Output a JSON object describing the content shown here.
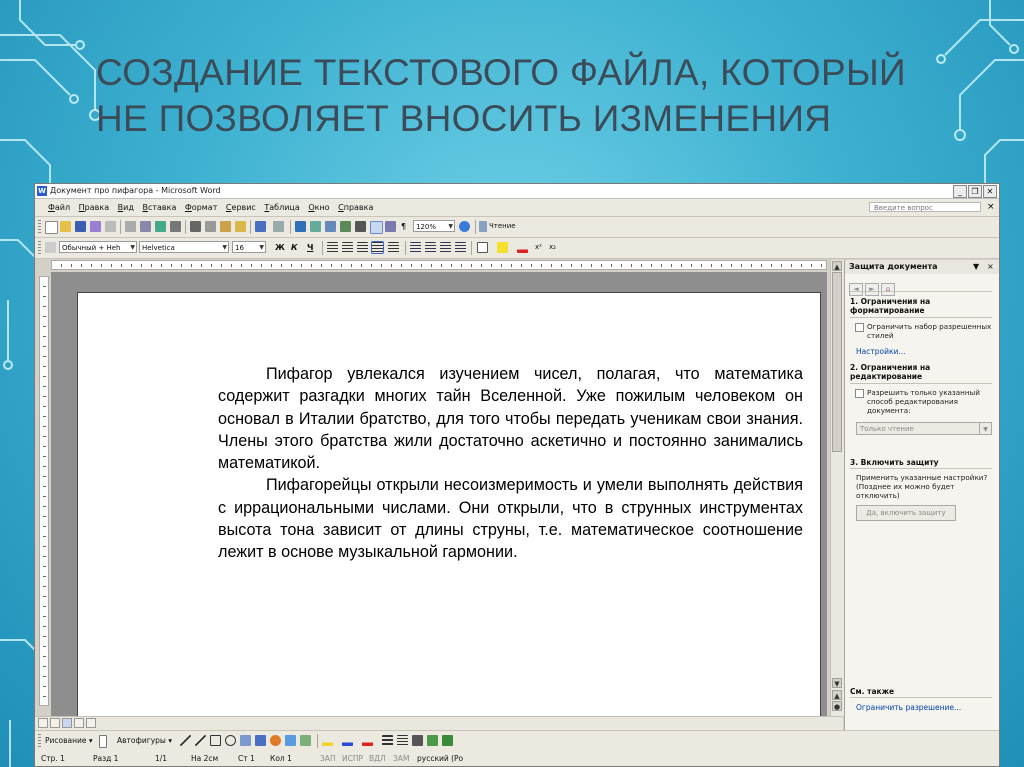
{
  "slide": {
    "title_line1": "СОЗДАНИЕ ТЕКСТОВОГО ФАЙЛА, КОТОРЫЙ",
    "title_line2": "НЕ ПОЗВОЛЯЕТ ВНОСИТЬ ИЗМЕНЕНИЯ"
  },
  "window": {
    "title": "Документ про пифагора - Microsoft Word",
    "icon_letter": "W",
    "minimize": "_",
    "restore": "❐",
    "close": "✕"
  },
  "menu": {
    "items": [
      "Файл",
      "Правка",
      "Вид",
      "Вставка",
      "Формат",
      "Сервис",
      "Таблица",
      "Окно",
      "Справка"
    ],
    "help_placeholder": "Введите вопрос",
    "help_close": "×"
  },
  "toolbar": {
    "zoom": "120%",
    "reading": "Чтение",
    "style": "Обычный + Неh",
    "font": "Helvetica",
    "size": "16",
    "bold": "Ж",
    "italic": "К",
    "underline": "Ч"
  },
  "document": {
    "paragraphs": [
      "Пифагор увлекался изучением чисел, полагая, что математика содержит разгадки многих тайн Вселенной. Уже пожилым человеком он основал в Италии братство, для того чтобы передать ученикам свои знания. Члены этого братства жили достаточно аскетично и постоянно занимались математикой.",
      "Пифагорейцы открыли несоизмеримость и умели выполнять действия с иррациональными числами. Они открыли, что в струнных инструментах высота тона зависит от длины струны, т.е. математическое соотношение лежит в основе музыкальной гармонии."
    ]
  },
  "taskpane": {
    "title": "Защита документа",
    "close": "×",
    "sec1": "1. Ограничения на форматирование",
    "sec1_check": "Ограничить набор разрешенных стилей",
    "sec1_link": "Настройки...",
    "sec2": "2. Ограничения на редактирование",
    "sec2_check": "Разрешить только указанный способ редактирования документа:",
    "sec2_combo": "Только чтение",
    "sec3": "3. Включить защиту",
    "sec3_text": "Применить указанные настройки? (Позднее их можно будет отключить)",
    "sec3_button": "Да, включить защиту",
    "see_also": "См. также",
    "see_also_link": "Ограничить разрешение..."
  },
  "drawbar": {
    "drawing": "Рисование",
    "autoshapes": "Автофигуры"
  },
  "status": {
    "page": "Стр. 1",
    "section": "Разд 1",
    "pages": "1/1",
    "at": "На 2см",
    "line": "Ст 1",
    "col": "Кол 1",
    "rec": "ЗАП",
    "trk": "ИСПР",
    "ext": "ВДЛ",
    "ovr": "ЗАМ",
    "lang": "русский (Ро"
  },
  "colors": {
    "slide_bg": "#3fb2d2",
    "title_text": "#3b4b57",
    "circuit": "#c9f2fb",
    "link": "#0044aa"
  }
}
